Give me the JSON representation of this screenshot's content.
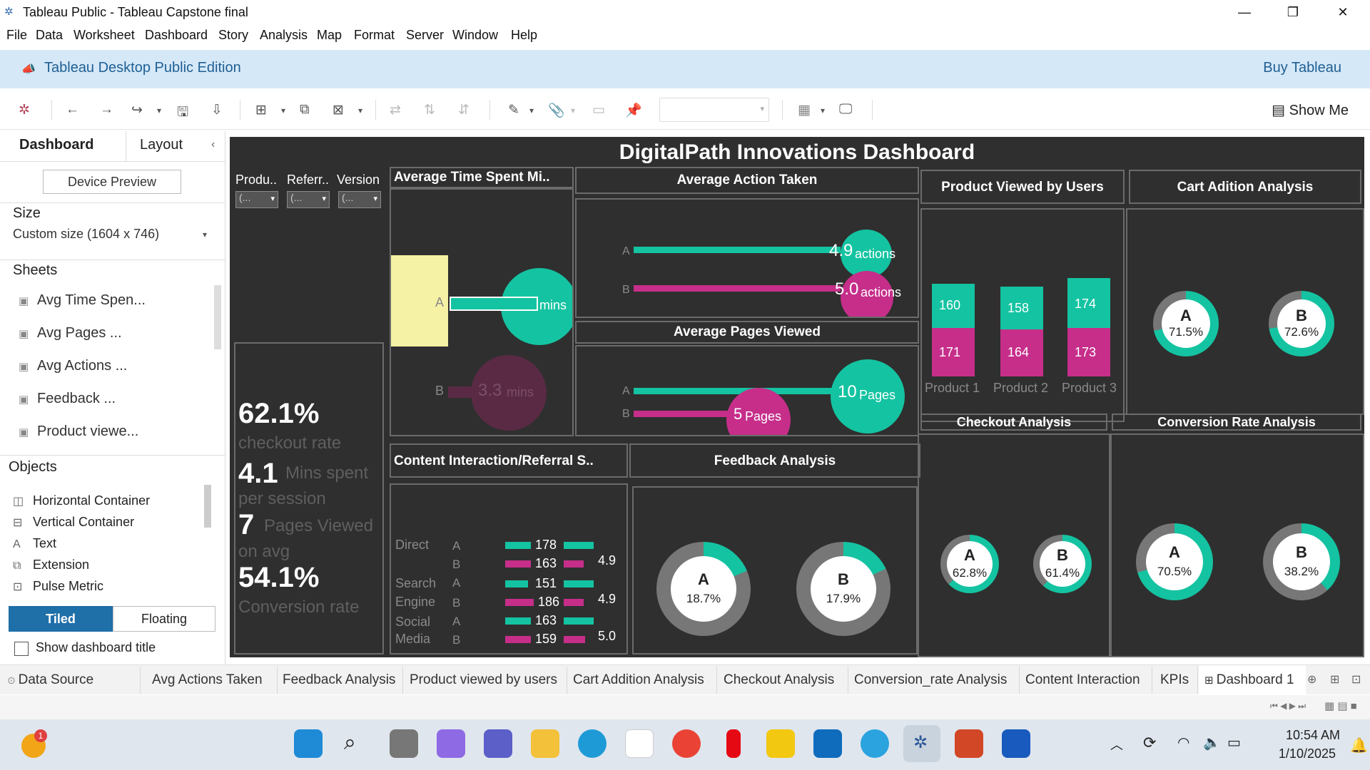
{
  "window": {
    "title": "Tableau Public - Tableau Capstone final",
    "minimize": "—",
    "maximize": "❐",
    "close": "✕"
  },
  "menu": [
    "File",
    "Data",
    "Worksheet",
    "Dashboard",
    "Story",
    "Analysis",
    "Map",
    "Format",
    "Server",
    "Window",
    "Help"
  ],
  "banner": {
    "edition": "Tableau Desktop Public Edition",
    "buy": "Buy Tableau"
  },
  "toolbar": {
    "show_me": "Show Me"
  },
  "left_panel": {
    "tabs": [
      "Dashboard",
      "Layout"
    ],
    "device_preview": "Device Preview",
    "size_title": "Size",
    "size_value": "Custom size (1604 x 746)",
    "sheets_title": "Sheets",
    "sheets": [
      "Avg Time Spen...",
      "Avg Pages ...",
      "Avg Actions ...",
      "Feedback ...",
      "Product viewe..."
    ],
    "objects_title": "Objects",
    "objects": [
      "Horizontal Container",
      "Vertical Container",
      "Text",
      "Extension",
      "Pulse Metric"
    ],
    "tiled": "Tiled",
    "floating": "Floating",
    "show_title": "Show dashboard title"
  },
  "dashboard": {
    "title": "DigitalPath Innovations Dashboard",
    "filters": [
      {
        "label": "Produ..",
        "value": "(..."
      },
      {
        "label": "Referr..",
        "value": "(..."
      },
      {
        "label": "Version",
        "value": "(..."
      }
    ],
    "kpis": {
      "checkout_value": "62.1%",
      "checkout_label": "checkout rate",
      "mins_value": "4.1",
      "mins_label_1": "Mins spent",
      "mins_label_2": "per session",
      "pages_value": "7",
      "pages_label_1": "Pages Viewed",
      "pages_label_2": "on avg",
      "conv_value": "54.1%",
      "conv_label": "Conversion rate"
    },
    "avg_time": {
      "title": "Average Time Spent Mi..",
      "a_label": "A",
      "a_unit": "mins",
      "b_label": "B",
      "b_value": "3.3",
      "b_unit": "mins"
    },
    "avg_action": {
      "title": "Average Action Taken",
      "a_label": "A",
      "a_value": "4.9",
      "b_label": "B",
      "b_value": "5.0",
      "unit": "actions"
    },
    "avg_pages": {
      "title": "Average Pages Viewed",
      "a_label": "A",
      "a_value": "10",
      "b_label": "B",
      "b_value": "5",
      "unit": "Pages"
    },
    "product_viewed": {
      "title": "Product Viewed by Users",
      "products": [
        {
          "name": "Product 1",
          "top": "160",
          "bottom": "171"
        },
        {
          "name": "Product 2",
          "top": "158",
          "bottom": "164"
        },
        {
          "name": "Product 3",
          "top": "174",
          "bottom": "173"
        }
      ]
    },
    "cart": {
      "title": "Cart Adition Analysis",
      "a_label": "A",
      "a_value": "71.5%",
      "b_label": "B",
      "b_value": "72.6%"
    },
    "checkout": {
      "title": "Checkout Analysis",
      "a_label": "A",
      "a_value": "62.8%",
      "b_label": "B",
      "b_value": "61.4%"
    },
    "conversion": {
      "title": "Conversion Rate Analysis",
      "a_label": "A",
      "a_value": "70.5%",
      "b_label": "B",
      "b_value": "38.2%"
    },
    "content": {
      "title": "Content Interaction/Referral S..",
      "rows": [
        {
          "source": "Direct",
          "version": "A",
          "value": "178",
          "avg": ""
        },
        {
          "source": "",
          "version": "B",
          "value": "163",
          "avg": "4.9"
        },
        {
          "source": "Search",
          "version": "A",
          "value": "151",
          "avg": ""
        },
        {
          "source": "Engine",
          "version": "B",
          "value": "186",
          "avg": "4.9"
        },
        {
          "source": "Social",
          "version": "A",
          "value": "163",
          "avg": ""
        },
        {
          "source": "Media",
          "version": "B",
          "value": "159",
          "avg": "5.0"
        }
      ]
    },
    "feedback": {
      "title": "Feedback Analysis",
      "a_label": "A",
      "a_value": "18.7%",
      "b_label": "B",
      "b_value": "17.9%"
    }
  },
  "tabs": [
    "Data Source",
    "Avg Actions Taken",
    "Feedback Analysis",
    "Product viewed by users",
    "Cart Addition Analysis",
    "Checkout Analysis",
    "Conversion_rate Analysis",
    "Content Interaction",
    "KPIs",
    "Dashboard 1"
  ],
  "clock": {
    "time": "10:54 AM",
    "date": "1/10/2025"
  },
  "notification_count": "1",
  "colors": {
    "teal": "#14c3a1",
    "pink": "#c62e8a",
    "dark": "#2f2f2f",
    "ring": "#777777",
    "brand_blue": "#1f5f93"
  }
}
